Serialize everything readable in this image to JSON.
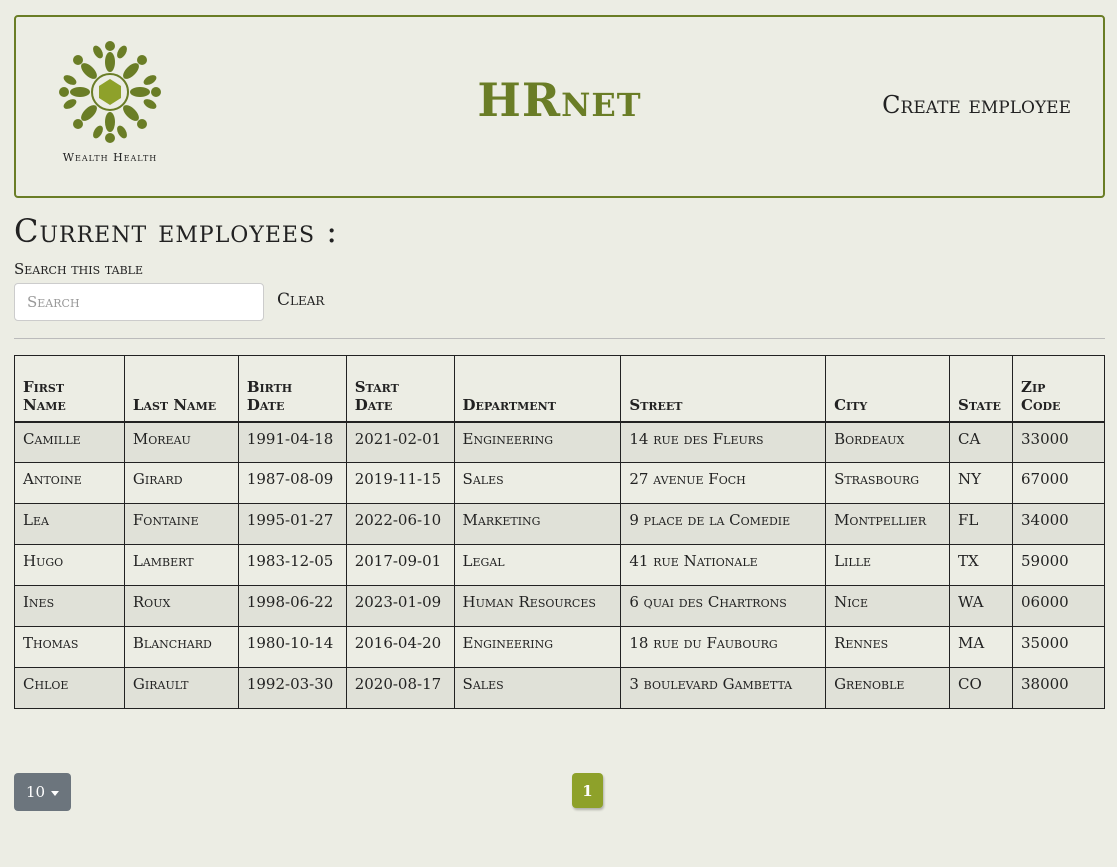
{
  "header": {
    "logo_text": "Wealth Health",
    "brand": "HRnet",
    "create_link": "Create employee"
  },
  "colors": {
    "accent": "#6a7d26",
    "pagination_active": "#8ea12a",
    "page_size_button": "#6c757d"
  },
  "main": {
    "title": "Current employees :",
    "search_label": "Search this table",
    "search_placeholder": "Search",
    "clear_label": "Clear"
  },
  "table": {
    "columns": [
      {
        "l1": "First",
        "l2": "Name"
      },
      {
        "l1": "",
        "l2": "Last Name"
      },
      {
        "l1": "Birth",
        "l2": "Date"
      },
      {
        "l1": "Start",
        "l2": "Date"
      },
      {
        "l1": "",
        "l2": "Department"
      },
      {
        "l1": "",
        "l2": "Street"
      },
      {
        "l1": "",
        "l2": "City"
      },
      {
        "l1": "",
        "l2": "State"
      },
      {
        "l1": "Zip",
        "l2": "Code"
      }
    ],
    "rows": [
      [
        "Camille",
        "Moreau",
        "1991-04-18",
        "2021-02-01",
        "Engineering",
        "14 rue des Fleurs",
        "Bordeaux",
        "CA",
        "33000"
      ],
      [
        "Antoine",
        "Girard",
        "1987-08-09",
        "2019-11-15",
        "Sales",
        "27 avenue Foch",
        "Strasbourg",
        "NY",
        "67000"
      ],
      [
        "Lea",
        "Fontaine",
        "1995-01-27",
        "2022-06-10",
        "Marketing",
        "9 place de la Comedie",
        "Montpellier",
        "FL",
        "34000"
      ],
      [
        "Hugo",
        "Lambert",
        "1983-12-05",
        "2017-09-01",
        "Legal",
        "41 rue Nationale",
        "Lille",
        "TX",
        "59000"
      ],
      [
        "Ines",
        "Roux",
        "1998-06-22",
        "2023-01-09",
        "Human Resources",
        "6 quai des Chartrons",
        "Nice",
        "WA",
        "06000"
      ],
      [
        "Thomas",
        "Blanchard",
        "1980-10-14",
        "2016-04-20",
        "Engineering",
        "18 rue du Faubourg",
        "Rennes",
        "MA",
        "35000"
      ],
      [
        "Chloe",
        "Girault",
        "1992-03-30",
        "2020-08-17",
        "Sales",
        "3 boulevard Gambetta",
        "Grenoble",
        "CO",
        "38000"
      ]
    ]
  },
  "pagination": {
    "page_size": "10",
    "current_page": "1"
  }
}
